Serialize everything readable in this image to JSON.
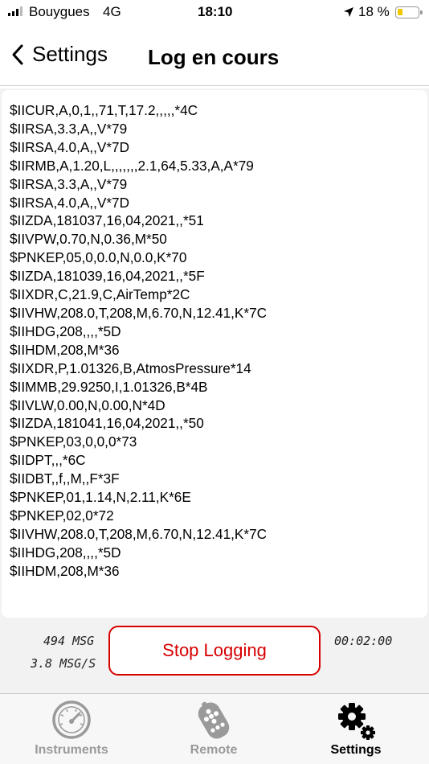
{
  "status": {
    "carrier": "Bouygues",
    "network": "4G",
    "time": "18:10",
    "battery": "18 %",
    "battery_color": "#f2c600"
  },
  "nav": {
    "back_label": "Settings",
    "title": "Log en cours"
  },
  "log": {
    "lines": [
      "$IICUR,A,0,1,,71,T,17.2,,,,,*4C",
      "$IIRSA,3.3,A,,V*79",
      "$IIRSA,4.0,A,,V*7D",
      "$IIRMB,A,1.20,L,,,,,,,2.1,64,5.33,A,A*79",
      "$IIRSA,3.3,A,,V*79",
      "$IIRSA,4.0,A,,V*7D",
      "$IIZDA,181037,16,04,2021,,*51",
      "$IIVPW,0.70,N,0.36,M*50",
      "$PNKEP,05,0,0.0,N,0.0,K*70",
      "$IIZDA,181039,16,04,2021,,*5F",
      "$IIXDR,C,21.9,C,AirTemp*2C",
      "$IIVHW,208.0,T,208,M,6.70,N,12.41,K*7C",
      "$IIHDG,208,,,,*5D",
      "$IIHDM,208,M*36",
      "$IIXDR,P,1.01326,B,AtmosPressure*14",
      "$IIMMB,29.9250,I,1.01326,B*4B",
      "$IIVLW,0.00,N,0.00,N*4D",
      "$IIZDA,181041,16,04,2021,,*50",
      "$PNKEP,03,0,0,0*73",
      "$IIDPT,,,*6C",
      "$IIDBT,,f,,M,,F*3F",
      "$PNKEP,01,1.14,N,2.11,K*6E",
      "$PNKEP,02,0*72",
      "$IIVHW,208.0,T,208,M,6.70,N,12.41,K*7C",
      "$IIHDG,208,,,,*5D",
      "$IIHDM,208,M*36"
    ]
  },
  "controls": {
    "msg_count": "494 MSG",
    "msg_rate": "3.8 MSG/S",
    "stop_label": "Stop Logging",
    "stop_color": "#d60000",
    "timer": "00:02:00"
  },
  "tabs": [
    {
      "label": "Instruments",
      "icon": "gauge-icon",
      "active": false
    },
    {
      "label": "Remote",
      "icon": "remote-icon",
      "active": false
    },
    {
      "label": "Settings",
      "icon": "gears-icon",
      "active": true
    }
  ]
}
